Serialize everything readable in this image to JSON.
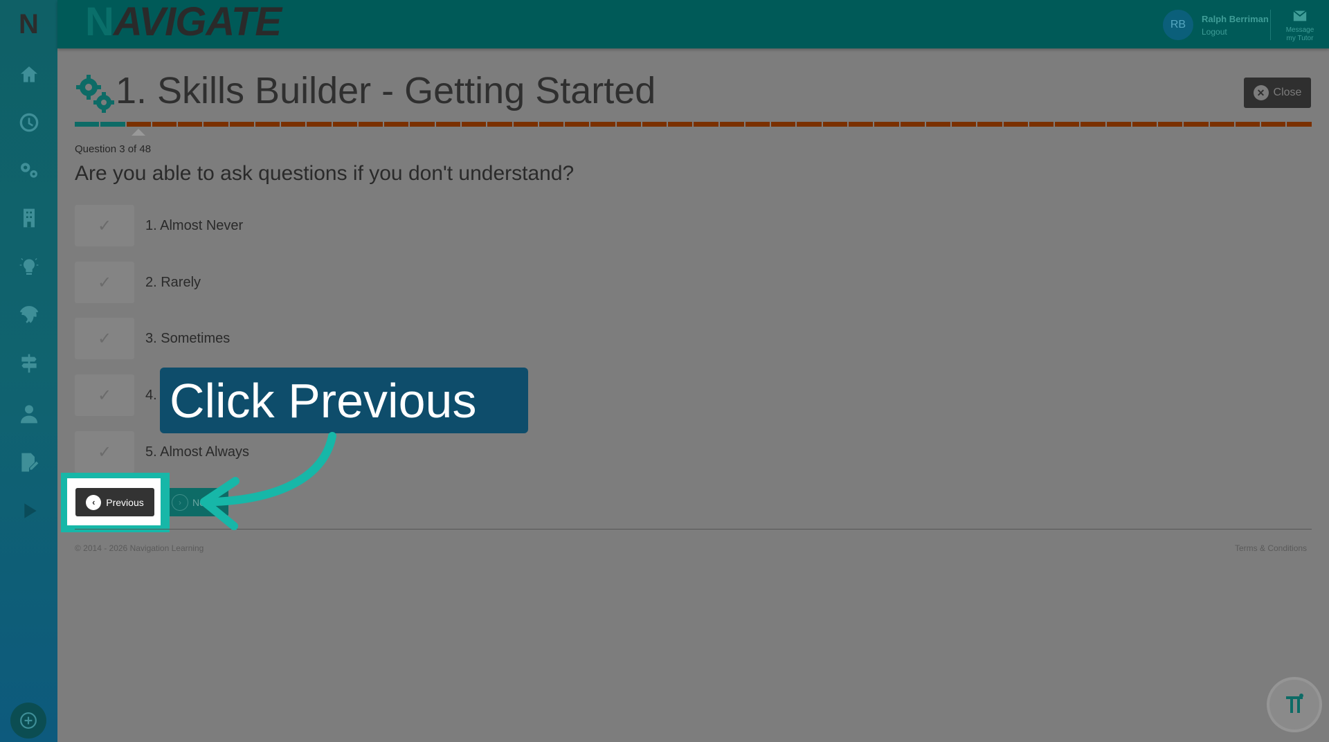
{
  "brand": {
    "text": "AVIGATE",
    "n": "N",
    "logo_letter": "N"
  },
  "user": {
    "initials": "RB",
    "name": "Ralph Berriman",
    "logout": "Logout"
  },
  "message": {
    "line1": "Message",
    "line2": "my Tutor"
  },
  "sidebar": {
    "items": [
      "home-icon",
      "clock-icon",
      "gears-icon",
      "building-icon",
      "lightbulb-icon",
      "fingerprint-icon",
      "signpost-icon",
      "person-icon",
      "edit-icon",
      "play-icon"
    ],
    "bottom": "plus-circle-icon"
  },
  "page": {
    "title": "1. Skills Builder - Getting Started",
    "close_label": "Close",
    "question_number": "Question 3 of 48",
    "question": "Are you able to ask questions if you don't understand?",
    "progress": {
      "total_segments": 48,
      "completed": 2
    }
  },
  "options": [
    {
      "label": "1. Almost Never"
    },
    {
      "label": "2. Rarely"
    },
    {
      "label": "3. Sometimes"
    },
    {
      "label": "4."
    },
    {
      "label": "5. Almost Always"
    }
  ],
  "buttons": {
    "previous": "Previous",
    "next": "Ne"
  },
  "footer": {
    "copyright": "© 2014 - 2026 Navigation Learning",
    "terms": "Terms & Conditions"
  },
  "callout": {
    "text": "Click Previous"
  },
  "colors": {
    "accent": "#17b7a8",
    "callout_bg": "#0e4d6b",
    "progress_done": "#0d6b66",
    "progress_todo": "#7a3000"
  }
}
